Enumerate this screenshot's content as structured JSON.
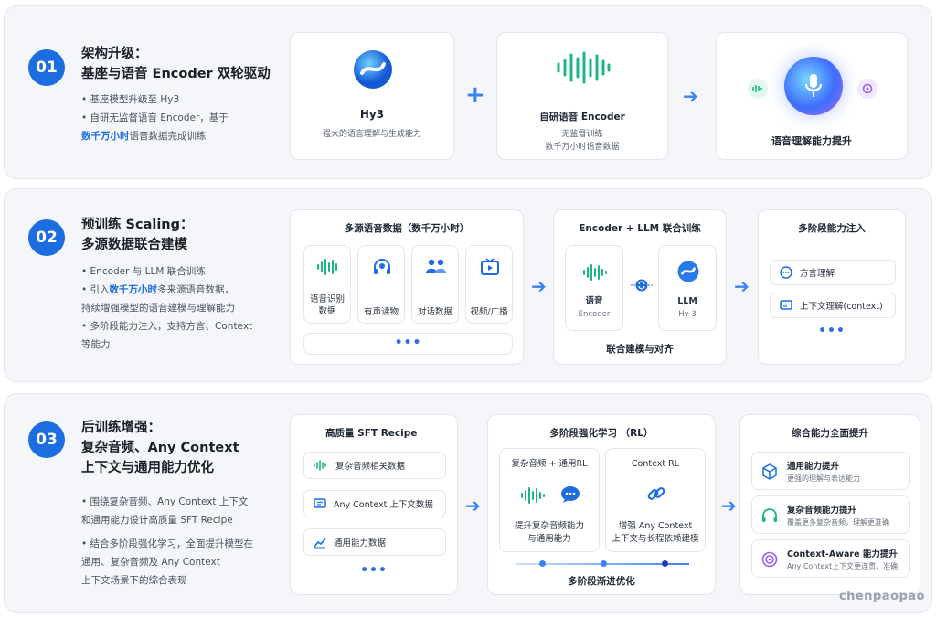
{
  "colors": {
    "accent": "#1b6de0",
    "green": "#1db48a",
    "background": "#f4f6f9"
  },
  "s1": {
    "num": "01",
    "title1": "架构升级：",
    "title2": "基座与语音 Encoder 双轮驱动",
    "b1": "• 基座模型升级至 Hy3",
    "b2": "• 自研无监督语音 Encoder，基于",
    "b3_hl": "数千万小时",
    "b3_rest": "语音数据完成训练",
    "hy3": {
      "name": "Hy3",
      "desc": "强大的语言理解与生成能力"
    },
    "encoder": {
      "name": "自研语音 Encoder",
      "l1": "无监督训练",
      "l2": "数千万小时语音数据"
    },
    "result": "语音理解能力提升"
  },
  "s2": {
    "num": "02",
    "title1": "预训练 Scaling：",
    "title2": "多源数据联合建模",
    "b1": "• Encoder 与 LLM 联合训练",
    "b2_pre": "• 引入",
    "b2_hl": "数千万小时",
    "b2_post": "多来源语音数据，",
    "b3": "持续增强模型的语音建模与理解能力",
    "b4": "• 多阶段能力注入，支持方言、Context",
    "b5": "等能力",
    "sources": {
      "title": "多源语音数据（数千万小时）",
      "items": [
        {
          "l1": "语音识别",
          "l2": "数据",
          "icon": "waveform-icon"
        },
        {
          "l1": "有声读物",
          "l2": "",
          "icon": "headphones-icon"
        },
        {
          "l1": "对话数据",
          "l2": "",
          "icon": "people-icon"
        },
        {
          "l1": "视频/广播",
          "l2": "",
          "icon": "video-icon"
        }
      ],
      "more": "•••"
    },
    "joint": {
      "title": "Encoder + LLM 联合训练",
      "enc": "语音",
      "enc_sub": "Encoder",
      "llm": "LLM",
      "llm_sub": "Hy 3",
      "caption": "联合建模与对齐"
    },
    "stages": {
      "title": "多阶段能力注入",
      "i1": "方言理解",
      "i2": "上下文理解(context)",
      "more": "•••"
    }
  },
  "s3": {
    "num": "03",
    "title1": "后训练增强：",
    "title2": "复杂音频、Any Context",
    "title3": "上下文与通用能力优化",
    "b1": "• 围绕复杂音频、Any Context 上下文",
    "b2": "和通用能力设计高质量 SFT Recipe",
    "b3": "• 结合多阶段强化学习，全面提升模型在",
    "b4": "通用、复杂音频及 Any Context",
    "b5": "上下文场景下的综合表现",
    "sft": {
      "title": "高质量 SFT Recipe",
      "i1": "复杂音频相关数据",
      "i2": "Any Context 上下文数据",
      "i3": "通用能力数据",
      "more": "•••"
    },
    "rl": {
      "title": "多阶段强化学习 （RL）",
      "left_title": "复杂音频 + 通用RL",
      "left_l1": "提升复杂音频能力",
      "left_l2": "与通用能力",
      "right_title": "Context RL",
      "right_l1": "增强 Any Context",
      "right_l2": "上下文与长程依赖建模",
      "caption": "多阶段渐进优化"
    },
    "overall": {
      "title": "综合能力全面提升",
      "items": [
        {
          "title": "通用能力提升",
          "desc": "更强的理解与表达能力",
          "icon": "cube-icon"
        },
        {
          "title": "复杂音频能力提升",
          "desc": "覆盖更多复杂音频，理解更准确",
          "icon": "headset-icon"
        },
        {
          "title": "Context-Aware 能力提升",
          "desc": "Any Context上下文更连贯，准确",
          "icon": "target-icon"
        }
      ]
    }
  },
  "watermark": "chenpaopao"
}
